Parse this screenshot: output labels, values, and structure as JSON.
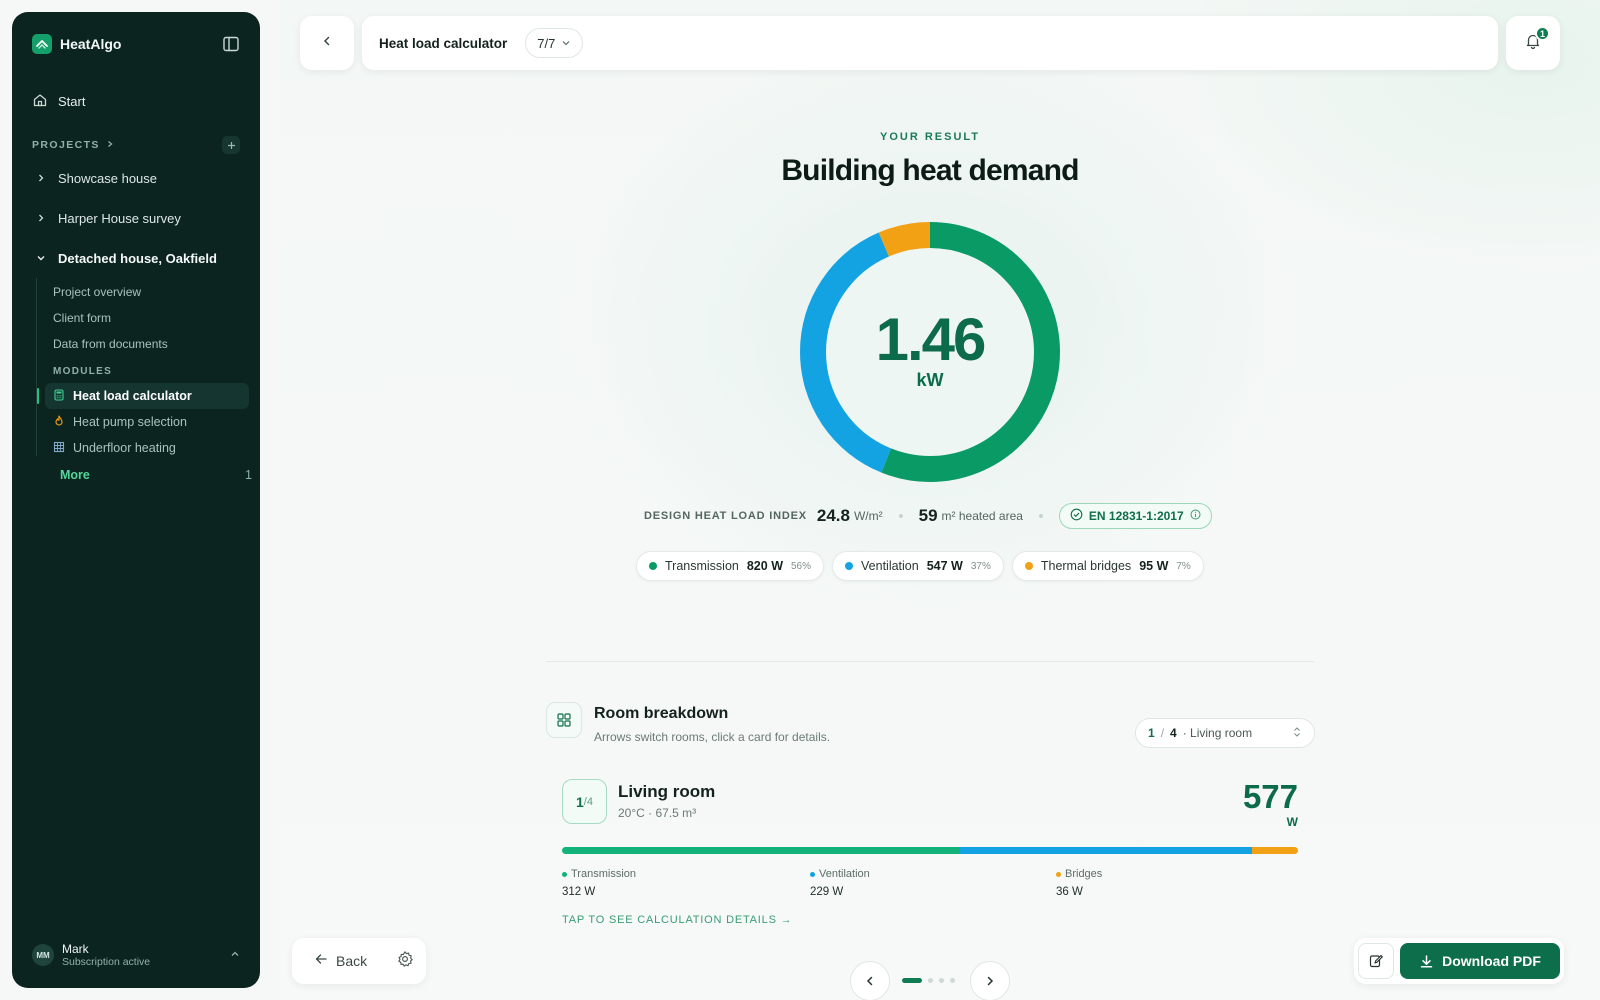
{
  "sidebar": {
    "brand": "HeatAlgo",
    "start_label": "Start",
    "projects_label": "PROJECTS",
    "projects": [
      {
        "label": "Showcase house"
      },
      {
        "label": "Harper House survey"
      },
      {
        "label": "Detached house, Oakfield"
      }
    ],
    "subitems": [
      "Project overview",
      "Client form",
      "Data from documents"
    ],
    "modules_label": "MODULES",
    "modules": [
      {
        "label": "Heat load calculator",
        "icon": "calculator-icon"
      },
      {
        "label": "Heat pump selection",
        "icon": "flame-icon"
      },
      {
        "label": "Underfloor heating",
        "icon": "grid-icon"
      }
    ],
    "more_label": "More",
    "more_count": "1",
    "user": {
      "initials": "MM",
      "name": "Mark",
      "status": "Subscription active"
    }
  },
  "topbar": {
    "title": "Heat load calculator",
    "step": "7/7",
    "notifications": "1"
  },
  "result": {
    "eyebrow": "YOUR RESULT",
    "title": "Building heat demand",
    "value": "1.46",
    "unit": "kW",
    "index_label": "DESIGN HEAT LOAD INDEX",
    "index_value": "24.8",
    "index_unit": "W/m²",
    "area_value": "59",
    "area_unit": "m² heated area",
    "standard": "EN 12831-1:2017"
  },
  "chart_data": {
    "type": "pie",
    "categories": [
      "Transmission",
      "Ventilation",
      "Thermal bridges"
    ],
    "values": [
      820,
      547,
      95
    ],
    "value_labels": [
      "820 W",
      "547 W",
      "95 W"
    ],
    "percent_labels": [
      "56%",
      "37%",
      "7%"
    ],
    "colors": [
      "#0a9a66",
      "#13a3e2",
      "#f2a014"
    ]
  },
  "breakdown": {
    "title": "Room breakdown",
    "subtitle": "Arrows switch rooms, click a card for details.",
    "selector": {
      "current": "1",
      "sep": "/",
      "total": "4",
      "name": "· Living room"
    },
    "room": {
      "index": "1",
      "of": "/4",
      "name": "Living room",
      "meta": "20°C · 67.5 m³",
      "watt": "577",
      "watt_unit": "W",
      "parts": [
        {
          "label": "Transmission",
          "value": "312 W",
          "watts": 312,
          "color": "#12b37a"
        },
        {
          "label": "Ventilation",
          "value": "229 W",
          "watts": 229,
          "color": "#13a3e2"
        },
        {
          "label": "Bridges",
          "value": "36 W",
          "watts": 36,
          "color": "#f2a014"
        }
      ]
    },
    "details_link": "TAP TO SEE CALCULATION DETAILS →"
  },
  "footer": {
    "back_label": "Back",
    "download_label": "Download PDF"
  }
}
